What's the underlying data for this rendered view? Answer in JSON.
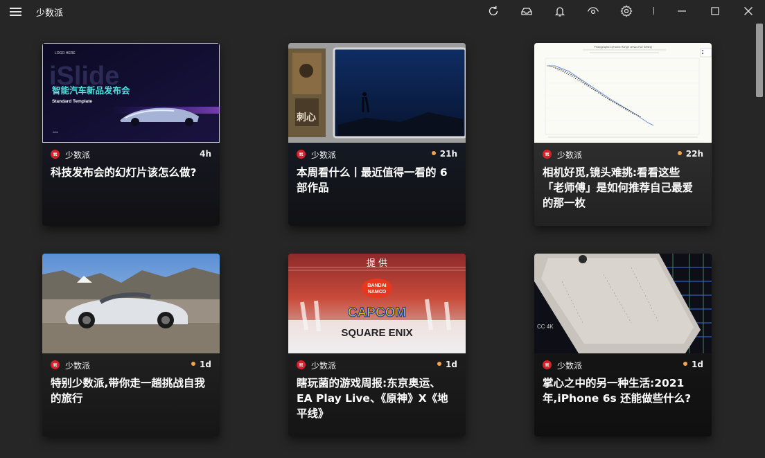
{
  "app": {
    "title": "少数派"
  },
  "toolbar": {
    "icons": [
      "refresh-icon",
      "inbox-icon",
      "bell-icon",
      "eye-icon",
      "gear-icon"
    ],
    "window_controls": [
      "minimize-icon",
      "maximize-icon",
      "close-icon"
    ]
  },
  "cards": [
    {
      "source": "少数派",
      "time": "4h",
      "unread": false,
      "title": "科技发布会的幻灯片该怎么做?",
      "thumb": {
        "logo_here": "LOGO HERE",
        "watermark": "iSlide",
        "headline": "智能汽车新品发布会",
        "sub": "Standard Template"
      }
    },
    {
      "source": "少数派",
      "time": "21h",
      "unread": true,
      "title": "本周看什么丨最近值得一看的 6 部作品",
      "thumb": {
        "poster_text": "刺心"
      }
    },
    {
      "source": "少数派",
      "time": "22h",
      "unread": true,
      "title": "相机好觅,镜头难挑:看看这些「老师傅」是如何推荐自己最爱的那一枚",
      "thumb": {
        "chart_title": "Photographic Dynamic Range versus ISO Setting"
      }
    },
    {
      "source": "少数派",
      "time": "1d",
      "unread": true,
      "title": "特别少数派,带你走一趟挑战自我的旅行",
      "thumb": {}
    },
    {
      "source": "少数派",
      "time": "1d",
      "unread": true,
      "title": "瞎玩菌的游戏周报:东京奥运、EA Play Live、《原神》X《地平线》",
      "thumb": {
        "provided": "提 供",
        "bandai": "BANDAI",
        "namco": "NAMCO",
        "capcom": "CAPCOM",
        "square": "SQUARE ENIX"
      }
    },
    {
      "source": "少数派",
      "time": "1d",
      "unread": true,
      "title": "掌心之中的另一种生活:2021 年,iPhone 6s 还能做些什么?",
      "thumb": {
        "board_text": "CC 4K"
      }
    }
  ],
  "colors": {
    "accent": "#d6222a",
    "unread_dot": "#f5a34a",
    "background": "#262626"
  }
}
